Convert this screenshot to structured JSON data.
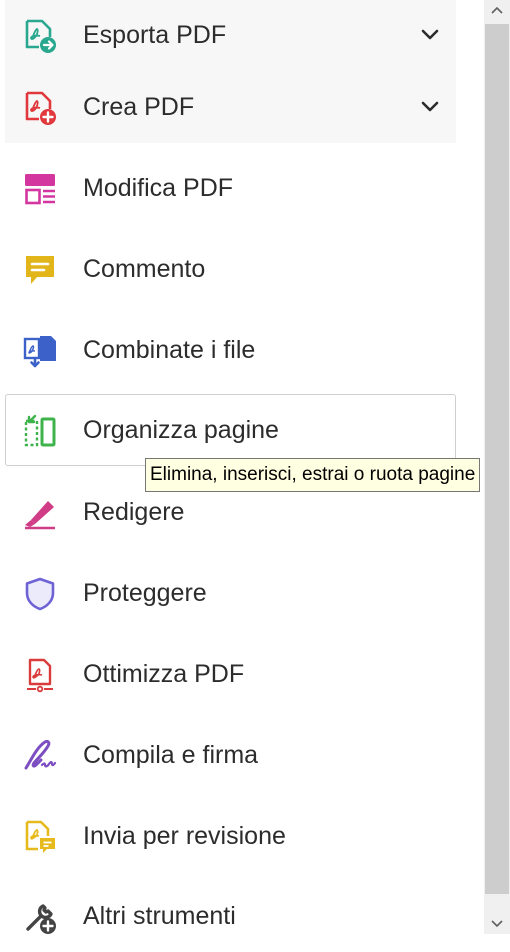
{
  "tools": [
    {
      "label": "Esporta PDF",
      "icon": "export-pdf-icon",
      "expandable": true
    },
    {
      "label": "Crea PDF",
      "icon": "create-pdf-icon",
      "expandable": true
    },
    {
      "label": "Modifica PDF",
      "icon": "edit-pdf-icon"
    },
    {
      "label": "Commento",
      "icon": "comment-icon"
    },
    {
      "label": "Combinate i file",
      "icon": "combine-files-icon"
    },
    {
      "label": "Organizza pagine",
      "icon": "organize-pages-icon",
      "hovered": true
    },
    {
      "label": "Redigere",
      "icon": "redact-icon"
    },
    {
      "label": "Proteggere",
      "icon": "protect-shield-icon"
    },
    {
      "label": "Ottimizza PDF",
      "icon": "optimize-pdf-icon"
    },
    {
      "label": "Compila e firma",
      "icon": "fill-sign-icon"
    },
    {
      "label": "Invia per revisione",
      "icon": "send-review-icon"
    },
    {
      "label": "Altri strumenti",
      "icon": "more-tools-icon"
    }
  ],
  "tooltip": {
    "text": "Elimina, inserisci, estrai o ruota pagine"
  },
  "colors": {
    "export": "#2aa78f",
    "create": "#e0383c",
    "edit": "#d3369f",
    "comment": "#e2b51a",
    "combine": "#3c61c9",
    "organize": "#3fb34b",
    "redact": "#d03d86",
    "protect": "#6d63d6",
    "optimize": "#da3c3c",
    "fill_sign": "#7d4ec2",
    "send_review": "#e6ba1c",
    "more_tools": "#444444"
  }
}
